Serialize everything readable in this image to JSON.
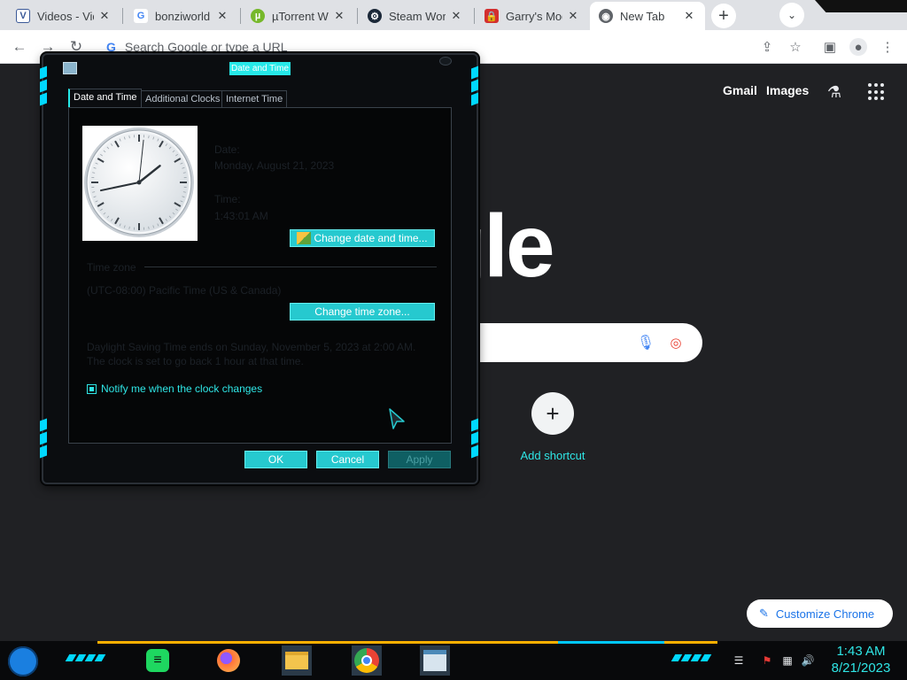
{
  "browser": {
    "tabs": [
      {
        "label": "Videos - Vid",
        "favicon": "v-icon",
        "color": "#3b5998"
      },
      {
        "label": "bonziworld -",
        "favicon": "google-icon",
        "color": "#4285f4"
      },
      {
        "label": "µTorrent We",
        "favicon": "utorrent-icon",
        "color": "#76b82a"
      },
      {
        "label": "Steam Work",
        "favicon": "steam-icon",
        "color": "#1b2838"
      },
      {
        "label": "Garry's Mod",
        "favicon": "lock-icon",
        "color": "#d32f2f"
      },
      {
        "label": "New Tab",
        "favicon": "chrome-icon",
        "color": "#5f6368"
      }
    ],
    "omnibox_placeholder": "Search Google or type a URL",
    "new_tab": "+",
    "tab_list": "⌄"
  },
  "newtab_page": {
    "gmail": "Gmail",
    "images": "Images",
    "logo_visible": "ogle",
    "add_shortcut": "Add shortcut",
    "tile_partial": "e",
    "customize": "Customize Chrome"
  },
  "dialog": {
    "title": "Date and Time",
    "tabs": [
      "Date and Time",
      "Additional Clocks",
      "Internet Time"
    ],
    "date_label": "Date:",
    "date_value": "Monday, August 21, 2023",
    "time_label": "Time:",
    "time_value": "1:43:01 AM",
    "change_datetime": "Change date and time...",
    "timezone_header": "Time zone",
    "timezone_value": "(UTC-08:00) Pacific Time (US & Canada)",
    "change_timezone": "Change time zone...",
    "dst_notice": "Daylight Saving Time ends on Sunday, November 5, 2023 at 2:00 AM. The clock is set to go back 1 hour at that time.",
    "notify": "Notify me when the clock changes",
    "notify_checked": true,
    "ok": "OK",
    "cancel": "Cancel",
    "apply": "Apply"
  },
  "clock_face": {
    "hour": 1,
    "minute": 43,
    "second": 1
  },
  "taskbar": {
    "time": "1:43 AM",
    "date": "8/21/2023",
    "pinned": [
      "spotify-icon",
      "firefox-icon",
      "file-explorer-icon",
      "chrome-icon",
      "calendar-icon"
    ]
  },
  "colors": {
    "accent": "#26e8e8",
    "chrome_tab_bg": "#dfe1e5",
    "page_bg": "#202124"
  }
}
